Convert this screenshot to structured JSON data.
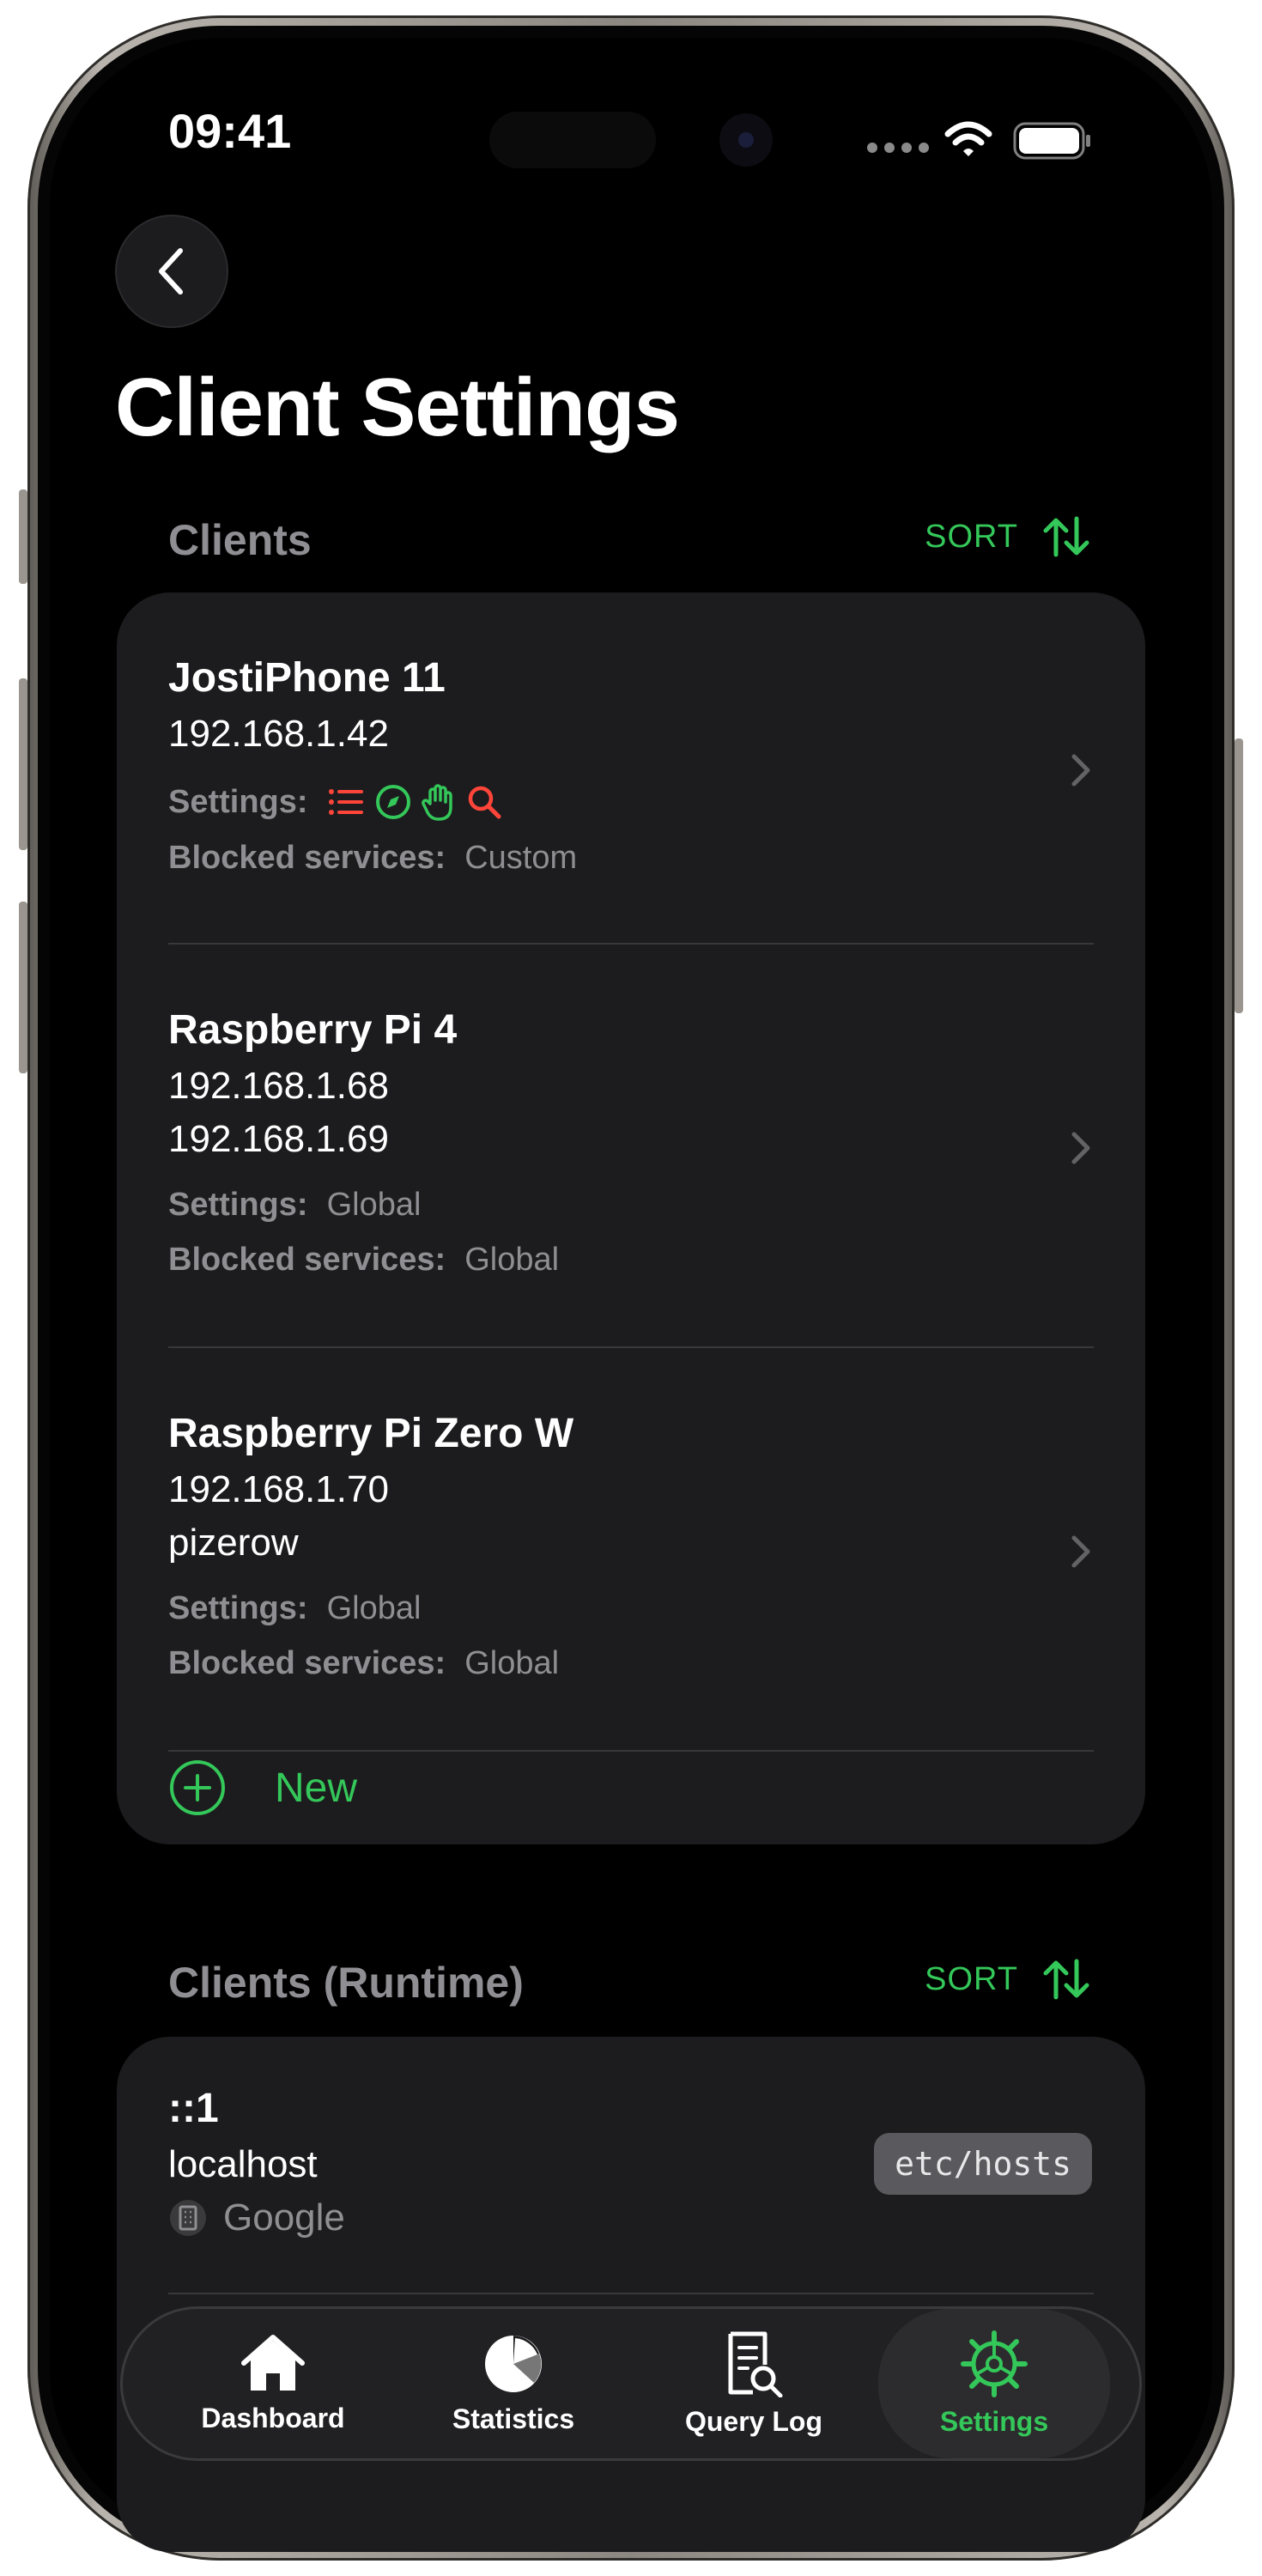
{
  "status_bar": {
    "time": "09:41"
  },
  "header": {
    "title": "Client Settings"
  },
  "clients_section": {
    "title": "Clients",
    "sort_label": "SORT",
    "clients": [
      {
        "name": "JostiPhone 11",
        "identifiers": [
          "192.168.1.42"
        ],
        "settings_label": "Settings:",
        "settings_icons": [
          {
            "icon": "list-icon",
            "color": "#ff453a"
          },
          {
            "icon": "compass-icon",
            "color": "#34c759"
          },
          {
            "icon": "hand-icon",
            "color": "#34c759"
          },
          {
            "icon": "search-icon",
            "color": "#ff453a"
          }
        ],
        "blocked_label": "Blocked services:",
        "blocked_value": "Custom"
      },
      {
        "name": "Raspberry Pi 4",
        "identifiers": [
          "192.168.1.68",
          "192.168.1.69"
        ],
        "settings_label": "Settings:",
        "settings_value": "Global",
        "blocked_label": "Blocked services:",
        "blocked_value": "Global"
      },
      {
        "name": "Raspberry Pi Zero W",
        "identifiers": [
          "192.168.1.70",
          "pizerow"
        ],
        "settings_label": "Settings:",
        "settings_value": "Global",
        "blocked_label": "Blocked services:",
        "blocked_value": "Global"
      }
    ],
    "new_label": "New"
  },
  "runtime_section": {
    "title": "Clients (Runtime)",
    "sort_label": "SORT",
    "clients": [
      {
        "name": "::1",
        "hostname": "localhost",
        "org": "Google",
        "source_tag": "etc/hosts"
      }
    ]
  },
  "tab_bar": {
    "tabs": [
      {
        "label": "Dashboard",
        "icon": "house-icon"
      },
      {
        "label": "Statistics",
        "icon": "pie-chart-icon"
      },
      {
        "label": "Query Log",
        "icon": "document-search-icon"
      },
      {
        "label": "Settings",
        "icon": "gear-icon",
        "active": true
      }
    ]
  },
  "colors": {
    "accent": "#34c759",
    "danger": "#ff453a",
    "card": "#1c1c1e",
    "secondary_text": "#8e8e93"
  }
}
